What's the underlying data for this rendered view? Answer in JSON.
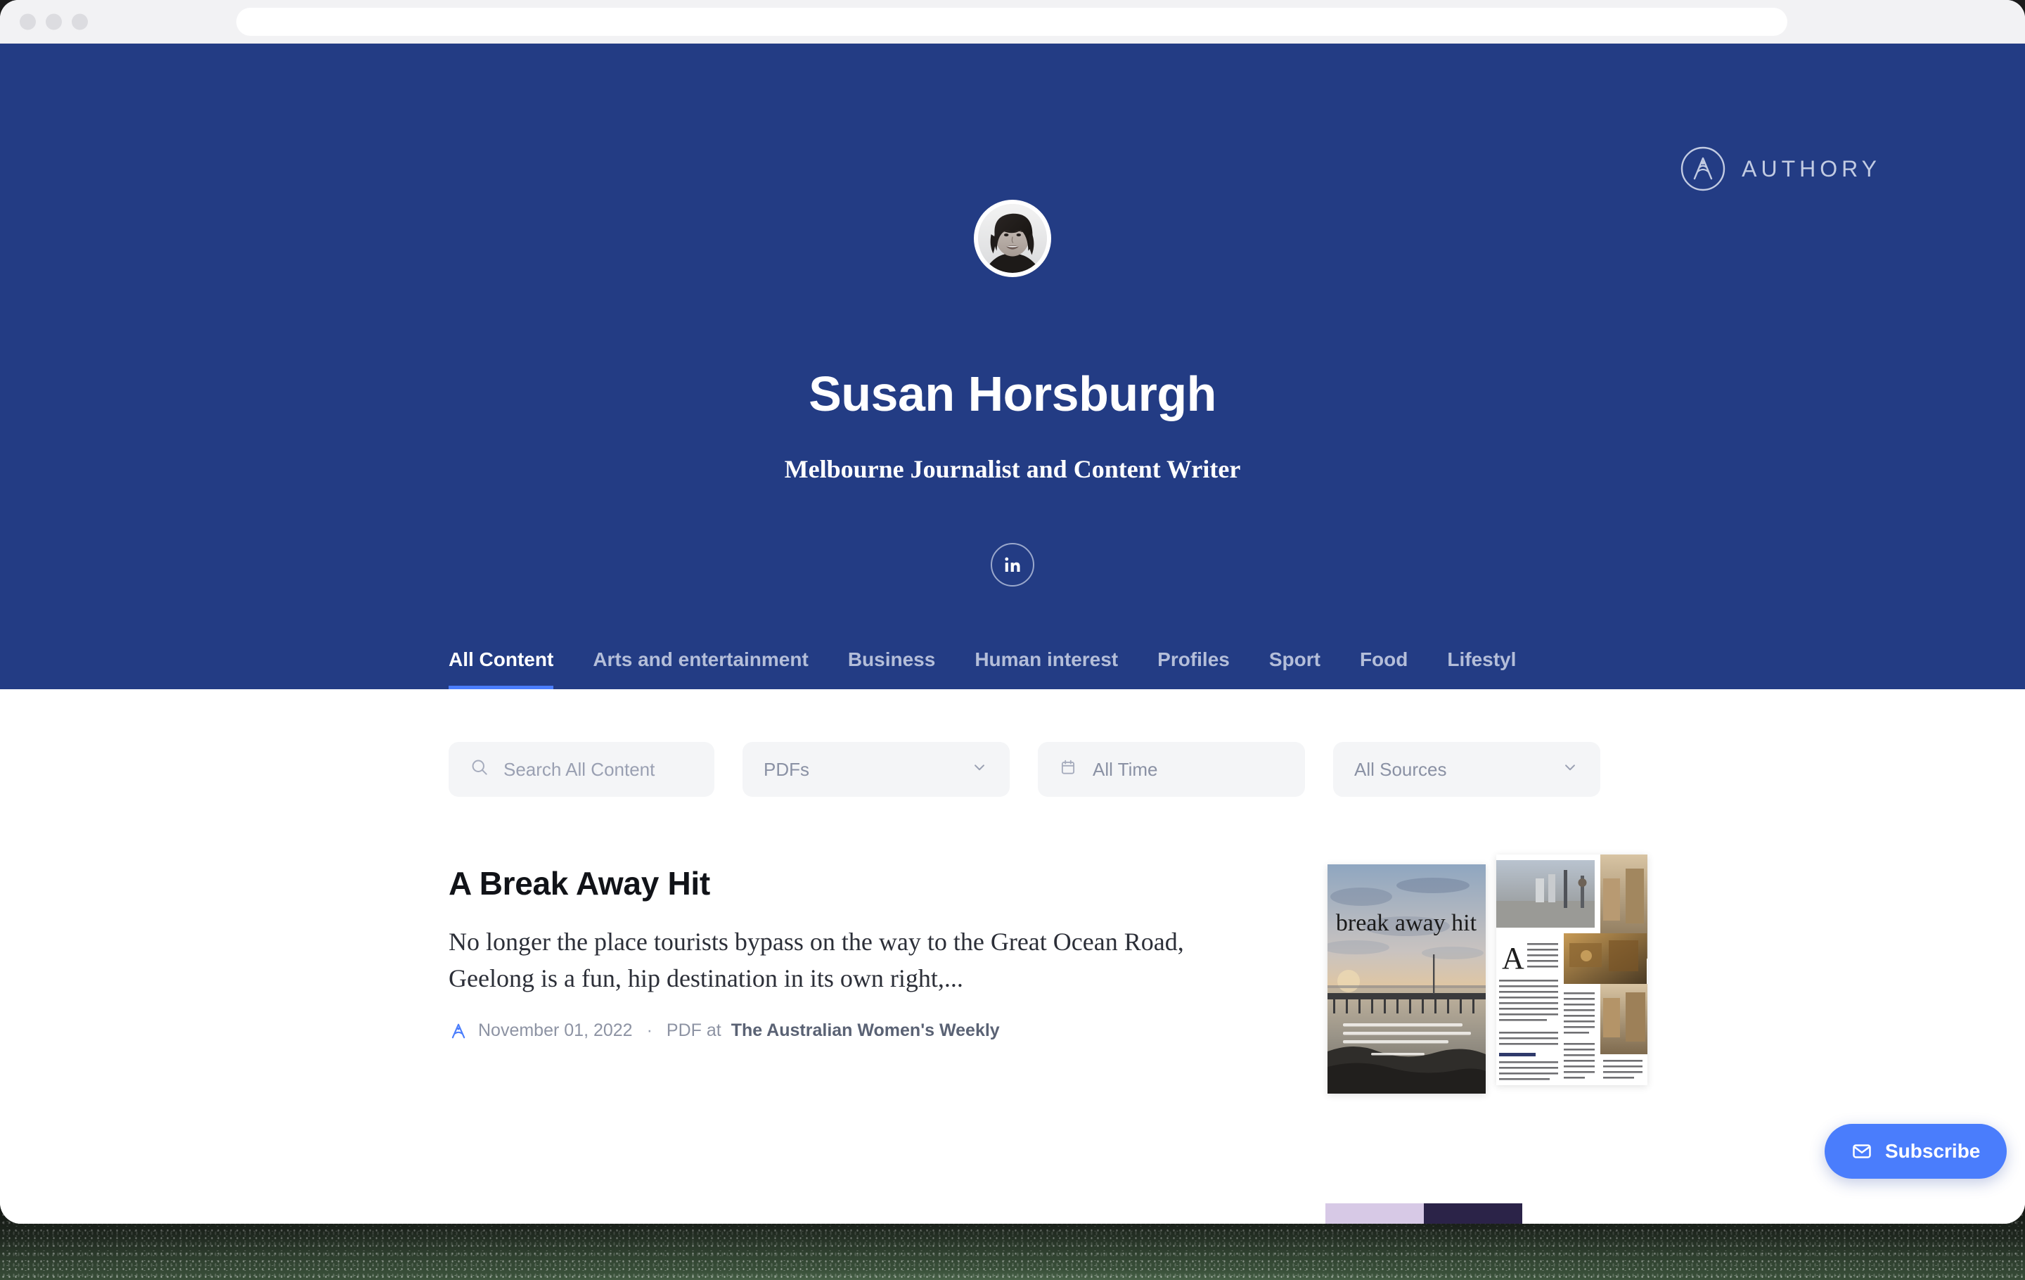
{
  "browser": {
    "traffic_lights": [
      "close",
      "minimize",
      "maximize"
    ],
    "url_value": "",
    "url_placeholder": ""
  },
  "brand": {
    "logo_icon": "authory-compass-a-icon",
    "wordmark": "AUTHORY"
  },
  "profile": {
    "avatar_alt": "Susan Horsburgh portrait",
    "name": "Susan Horsburgh",
    "tagline": "Melbourne Journalist and Content Writer",
    "social": [
      {
        "icon": "linkedin-icon",
        "label": "in"
      }
    ]
  },
  "tabs": [
    {
      "label": "All Content",
      "active": true
    },
    {
      "label": "Arts and entertainment",
      "active": false
    },
    {
      "label": "Business",
      "active": false
    },
    {
      "label": "Human interest",
      "active": false
    },
    {
      "label": "Profiles",
      "active": false
    },
    {
      "label": "Sport",
      "active": false
    },
    {
      "label": "Food",
      "active": false
    },
    {
      "label": "Lifestyl",
      "active": false
    }
  ],
  "filters": {
    "search": {
      "icon": "search-icon",
      "value": "",
      "placeholder": "Search All Content"
    },
    "type": {
      "value": "PDFs",
      "icon": "chevron-down-icon"
    },
    "date": {
      "icon": "calendar-icon",
      "value": "All Time"
    },
    "sources": {
      "value": "All Sources",
      "icon": "chevron-down-icon"
    }
  },
  "articles": [
    {
      "title": "A Break Away Hit",
      "excerpt": "No longer the place tourists bypass on the way to the Great Ocean Road, Geelong is a fun, hip destination in its own right,...",
      "meta_logo": "authory-a-icon",
      "date": "November 01, 2022",
      "separator": "·",
      "format_label": "PDF at",
      "source_name": "The Australian Women's Weekly",
      "thumbnail_alt": "Magazine spread: break away hit — pier at sunset and photo collage",
      "thumbnail_headline": "break away hit"
    }
  ],
  "subscribe": {
    "icon": "envelope-icon",
    "label": "Subscribe"
  },
  "colors": {
    "hero_blue": "#233c84",
    "accent_blue": "#4a7dfc",
    "panel_white": "#ffffff",
    "toolbar_gray": "#f2f2f4",
    "filter_gray": "#f4f5f7"
  }
}
